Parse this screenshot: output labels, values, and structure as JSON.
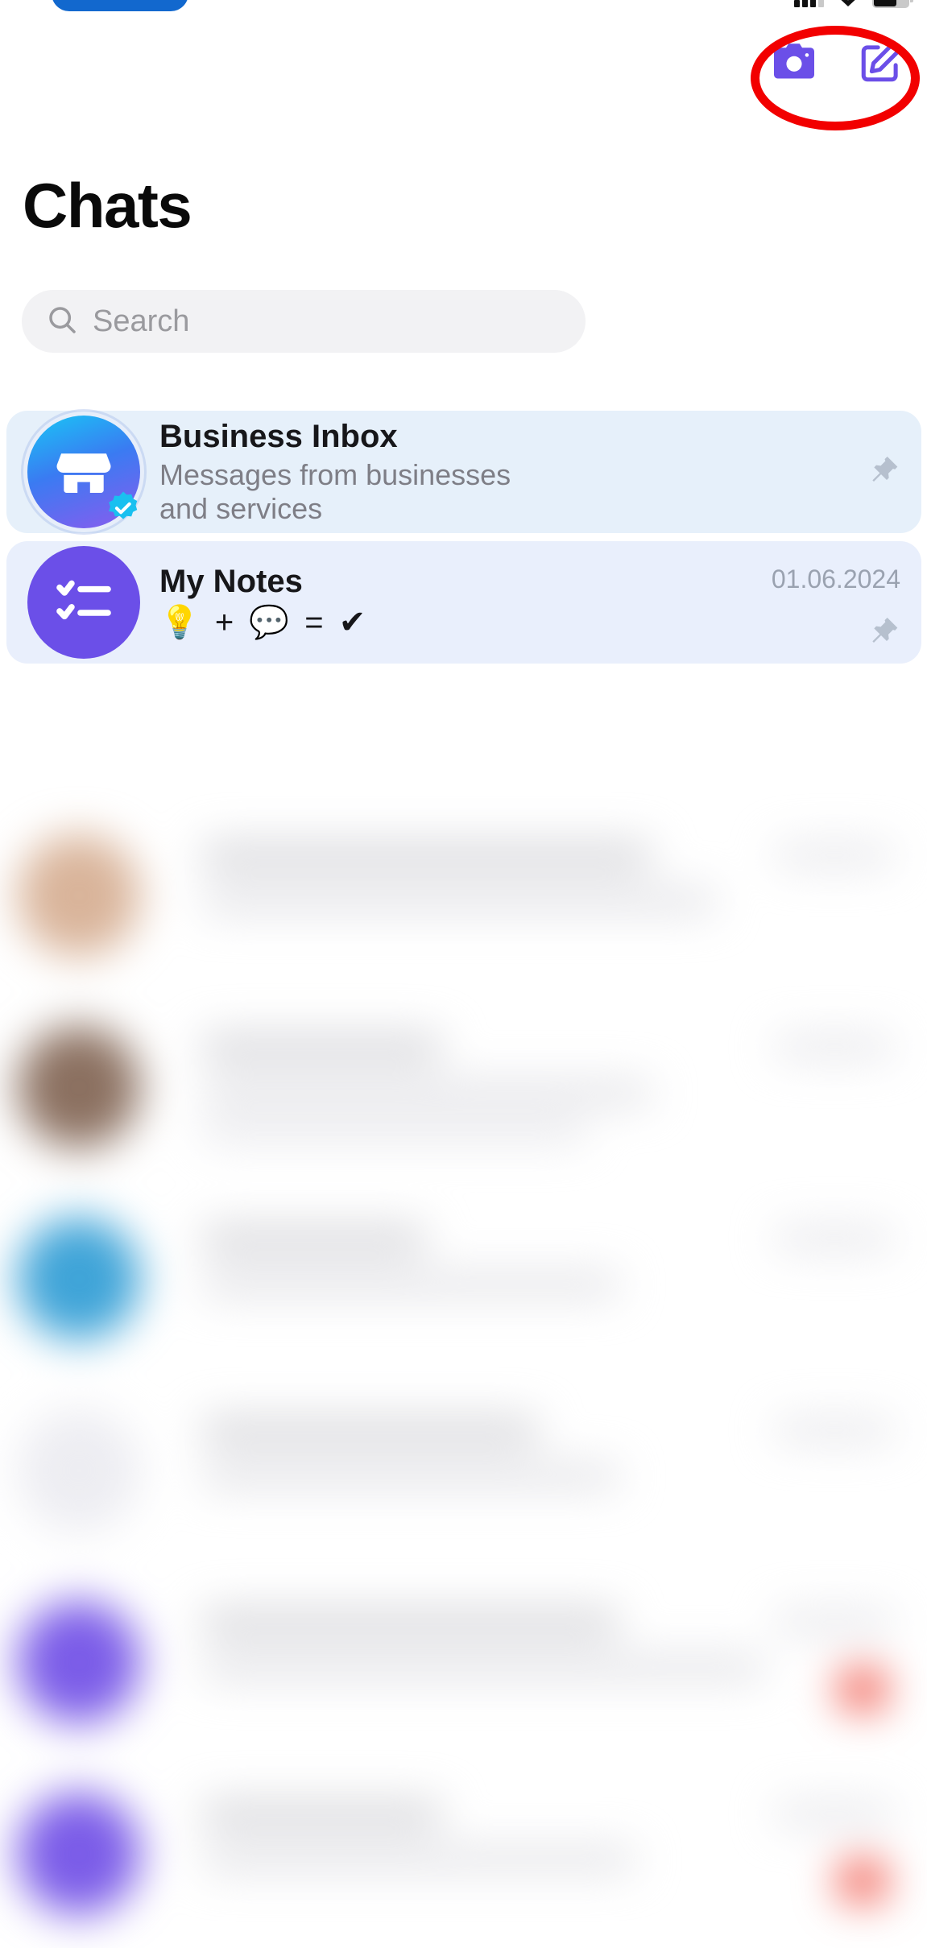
{
  "status_bar": {
    "island": "dynamic-island",
    "signal": "cellular-signal",
    "wifi": "wifi-icon",
    "battery": "battery-icon"
  },
  "toolbar": {
    "camera_icon": "camera-icon",
    "compose_icon": "compose-edit-icon",
    "accent_purple": "#6B4FE8",
    "highlight_color": "#F20000"
  },
  "header": {
    "title": "Chats"
  },
  "search": {
    "placeholder": "Search",
    "icon": "search-icon",
    "background": "#F2F2F4"
  },
  "chats": [
    {
      "name": "Business Inbox",
      "subtitle": "Messages from businesses\nand services",
      "date": "",
      "pinned": true,
      "pin_icon": "pushpin-icon",
      "avatar_icon": "storefront-icon",
      "verified": true,
      "verified_icon": "verified-badge-icon",
      "card_background": "#E6F0FA"
    },
    {
      "name": "My Notes",
      "subtitle": "💡 + 💬 = ✔",
      "date": "01.06.2024",
      "pinned": true,
      "pin_icon": "pushpin-icon",
      "avatar_icon": "checklist-icon",
      "verified": false,
      "card_background": "#E9EFFC"
    }
  ],
  "blurred_list": {
    "note": "blurred-chat-rows",
    "rows": [
      {
        "avatar_color": "#D9B49A",
        "name_width": 560,
        "msg1_width": 640,
        "msg2_width": 0,
        "badge": ""
      },
      {
        "avatar_color": "#8B7060",
        "name_width": 300,
        "msg1_width": 560,
        "msg2_width": 480,
        "badge": ""
      },
      {
        "avatar_color": "#3FA4D8",
        "name_width": 280,
        "msg1_width": 520,
        "msg2_width": 0,
        "badge": ""
      },
      {
        "avatar_color": "#EDEDF2",
        "name_width": 420,
        "msg1_width": 520,
        "msg2_width": 0,
        "badge": ""
      },
      {
        "avatar_color": "#7B5CE8",
        "name_width": 520,
        "msg1_width": 700,
        "msg2_width": 0,
        "badge": "#F05A4E"
      },
      {
        "avatar_color": "#7B5CE8",
        "name_width": 300,
        "msg1_width": 540,
        "msg2_width": 0,
        "badge": "#F05A4E"
      }
    ]
  }
}
